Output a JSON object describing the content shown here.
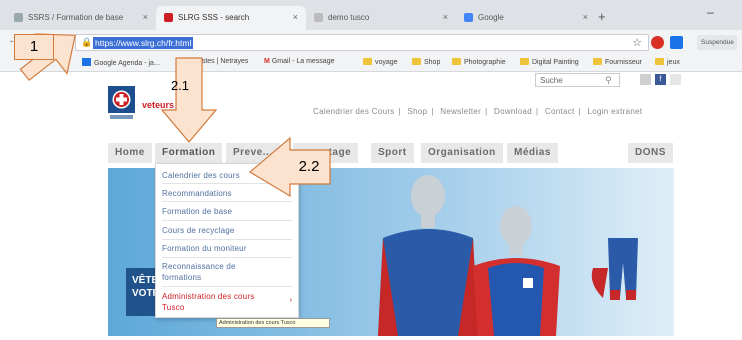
{
  "browser": {
    "tabs": [
      {
        "title": "SSRS / Formation de base"
      },
      {
        "title": "SLRG SSS - search"
      },
      {
        "title": "demo tusco"
      },
      {
        "title": "Google"
      }
    ],
    "new_tab": "+",
    "window_minimize": "–",
    "url": "https://www.slrg.ch/fr.html",
    "star": "☆",
    "profile_label": "Suspendue",
    "bookmarks": [
      "Google Agenda - ja...",
      "...stes | Netrayes",
      "Gmail - La message",
      "voyage",
      "Shop",
      "Photographie",
      "Digital Painting",
      "Fournisseur",
      "jeux"
    ],
    "bookmarks_prefix": "ic"
  },
  "site": {
    "search_placeholder": "Suche",
    "logo_caption": "veteurs",
    "top_links": [
      "Calendrier des Cours",
      "Shop",
      "Newsletter",
      "Download",
      "Contact",
      "Login extranet"
    ],
    "nav": [
      "Home",
      "Formation",
      "Preve...",
      "...uvetage",
      "Sport",
      "Organisation",
      "Médias",
      "DONS"
    ],
    "hero_banner": [
      "VÊTE",
      "VOTR"
    ],
    "dropdown": [
      "Calendrier des cours",
      "Recommandations",
      "Formation de base",
      "Cours de recyclage",
      "Formation du moniteur",
      "Reconnaissance de",
      "formations",
      "Administration des cours",
      "Tusco"
    ],
    "tooltip": "Administration des cours Tusco"
  },
  "annotations": {
    "callout_1": "1",
    "callout_21": "2.1",
    "callout_22": "2.2"
  },
  "colors": {
    "accent_red": "#cc1f24",
    "url_highlight": "#3b6fd6",
    "callout_fill": "#fbe3cf",
    "callout_stroke": "#d27a3b",
    "hero_blue": "#20528c"
  }
}
